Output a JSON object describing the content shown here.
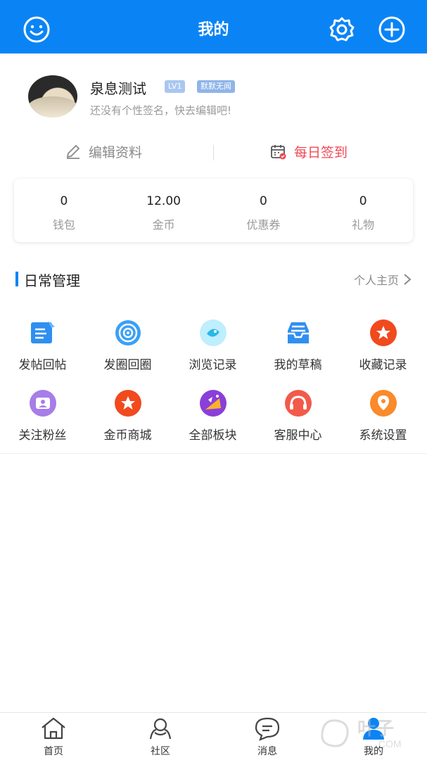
{
  "header": {
    "title": "我的",
    "background": "#0a84f5",
    "left_icon": "smiley-icon",
    "right_icons": [
      "gear-icon",
      "plus-circle-icon"
    ]
  },
  "profile": {
    "name": "泉息测试",
    "level": "LV1",
    "tag": "默默无闻",
    "signature": "还没有个性签名，快去编辑吧!"
  },
  "actions": {
    "edit_label": "编辑资料",
    "signin_label": "每日签到",
    "signin_color": "#ef4a55"
  },
  "stats": [
    {
      "value": "0",
      "label": "钱包"
    },
    {
      "value": "12.00",
      "label": "金币"
    },
    {
      "value": "0",
      "label": "优惠券"
    },
    {
      "value": "0",
      "label": "礼物"
    }
  ],
  "section": {
    "title": "日常管理",
    "link": "个人主页"
  },
  "grid": [
    {
      "label": "发帖回帖",
      "icon": "post-icon"
    },
    {
      "label": "发圈回圈",
      "icon": "circle-icon"
    },
    {
      "label": "浏览记录",
      "icon": "history-icon"
    },
    {
      "label": "我的草稿",
      "icon": "drafts-icon"
    },
    {
      "label": "收藏记录",
      "icon": "star-icon"
    },
    {
      "label": "关注粉丝",
      "icon": "followers-icon"
    },
    {
      "label": "金币商城",
      "icon": "shop-star-icon"
    },
    {
      "label": "全部板块",
      "icon": "boards-icon"
    },
    {
      "label": "客服中心",
      "icon": "support-icon"
    },
    {
      "label": "系统设置",
      "icon": "settings-pin-icon"
    }
  ],
  "bottom_nav": [
    {
      "label": "首页",
      "icon": "home-icon"
    },
    {
      "label": "社区",
      "icon": "community-icon"
    },
    {
      "label": "消息",
      "icon": "message-icon"
    },
    {
      "label": "我的",
      "icon": "profile-icon",
      "active": true
    }
  ],
  "watermark": {
    "text": "叶子",
    "sub": ".COM"
  }
}
